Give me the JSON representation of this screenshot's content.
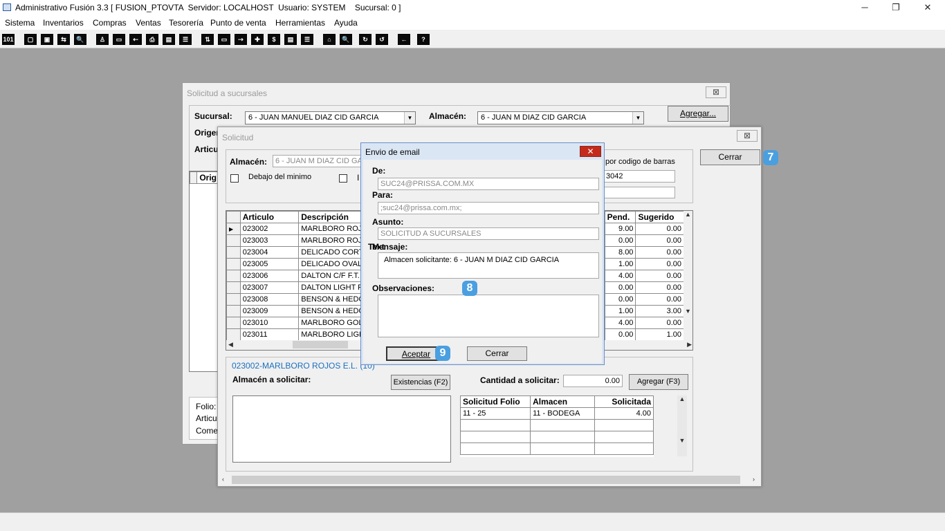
{
  "app": {
    "title": "Administrativo Fusión 3.3 [ FUSION_PTOVTA  Servidor: LOCALHOST  Usuario: SYSTEM    Sucursal: 0 ]",
    "minimize": "─",
    "restore": "❐",
    "close": "✕"
  },
  "menu": [
    "Sistema",
    "Inventarios",
    "Compras",
    "Ventas",
    "Tesorería",
    "Punto de venta",
    "Herramientas",
    "Ayuda"
  ],
  "toolbar": [
    "101",
    "▢",
    "▣",
    "⇆",
    "🔍",
    "♙",
    "▭",
    "⇠",
    "⎙",
    "▤",
    "☰",
    "⇅",
    "▭",
    "⇢",
    "✚",
    "$",
    "▤",
    "☰",
    "⌂",
    "🔍",
    "↻",
    "↺",
    "←",
    "?"
  ],
  "solicitud_sucursales": {
    "title": "Solicitud a sucursales",
    "sucursal_label": "Sucursal:",
    "sucursal_value": "6 - JUAN MANUEL DIAZ CID GARCIA",
    "almacen_label": "Almacén:",
    "almacen_value": "6 - JUAN M DIAZ CID GARCIA",
    "agregar": "Agregar...",
    "origen_label": "Origen",
    "articulo_label": "Articu",
    "grid_header": "Orig",
    "folio_label": "Folio:",
    "articulo2_label": "Articul",
    "comentario_label": "Comen",
    "close_icon": "⊠"
  },
  "solicitud": {
    "title": "Solicitud",
    "almacen_label": "Almacén:",
    "almacen_value": "6     - JUAN M DIAZ CID GA",
    "debajo_label": "Debajo del minimo",
    "i_label": "I",
    "barras_label": "por codigo de barras",
    "barras_value": "3042",
    "cerrar": "Cerrar",
    "columns": [
      "Articulo",
      "Descripción",
      "Pend.",
      "Sugerido"
    ],
    "rows": [
      {
        "articulo": "023002",
        "descripcion": "MARLBORO ROJO",
        "pend": "9.00",
        "sugerido": "0.00"
      },
      {
        "articulo": "023003",
        "descripcion": "MARLBORO ROJO",
        "pend": "0.00",
        "sugerido": "0.00"
      },
      {
        "articulo": "023004",
        "descripcion": "DELICADO CORTO",
        "pend": "8.00",
        "sugerido": "0.00"
      },
      {
        "articulo": "023005",
        "descripcion": "DELICADO OVALA",
        "pend": "1.00",
        "sugerido": "0.00"
      },
      {
        "articulo": "023006",
        "descripcion": "DALTON C/F F.T.",
        "pend": "4.00",
        "sugerido": "0.00"
      },
      {
        "articulo": "023007",
        "descripcion": "DALTON LIGHT F.",
        "pend": "0.00",
        "sugerido": "0.00"
      },
      {
        "articulo": "023008",
        "descripcion": "BENSON & HEDGE",
        "pend": "0.00",
        "sugerido": "0.00"
      },
      {
        "articulo": "023009",
        "descripcion": "BENSON & HEDGE",
        "pend": "1.00",
        "sugerido": "3.00"
      },
      {
        "articulo": "023010",
        "descripcion": "MARLBORO GOLD",
        "pend": "4.00",
        "sugerido": "0.00"
      },
      {
        "articulo": "023011",
        "descripcion": "MARLBORO LIGHT",
        "pend": "0.00",
        "sugerido": "1.00"
      }
    ],
    "selected_item": "023002-MARLBORO ROJOS E.L. (10)",
    "almacen_solicitar": "Almacén a solicitar:",
    "existencias": "Existencias (F2)",
    "cantidad_label": "Cantidad a solicitar:",
    "cantidad_value": "0.00",
    "agregar_f3": "Agregar (F3)",
    "sub_columns": [
      "Solicitud Folio",
      "Almacen",
      "Solicitada"
    ],
    "sub_rows": [
      {
        "folio": "11 - 25",
        "almacen": "11   - BODEGA",
        "solicitada": "4.00"
      }
    ],
    "close_icon": "⊠"
  },
  "email": {
    "title": "Envio de email",
    "de_label": "De:",
    "de_value": "SUC24@PRISSA.COM.MX",
    "para_label": "Para:",
    "para_value": ";suc24@prissa.com.mx;",
    "asunto_label": "Asunto:",
    "asunto_value": "SOLICITUD A SUCURSALES",
    "overlap_label": "Text",
    "mensaje_label": "Mensaje:",
    "mensaje_value": "Almacen solicitante: 6     - JUAN M DIAZ CID GARCIA",
    "obs_label": "Observaciones:",
    "aceptar": "Aceptar",
    "cerrar": "Cerrar",
    "close_icon": "✕"
  },
  "badges": {
    "b7": "7",
    "b8": "8",
    "b9": "9"
  },
  "colors": {
    "badge": "#4a9fe0",
    "close_red": "#c42b1c",
    "link_blue": "#1a6fc0"
  }
}
